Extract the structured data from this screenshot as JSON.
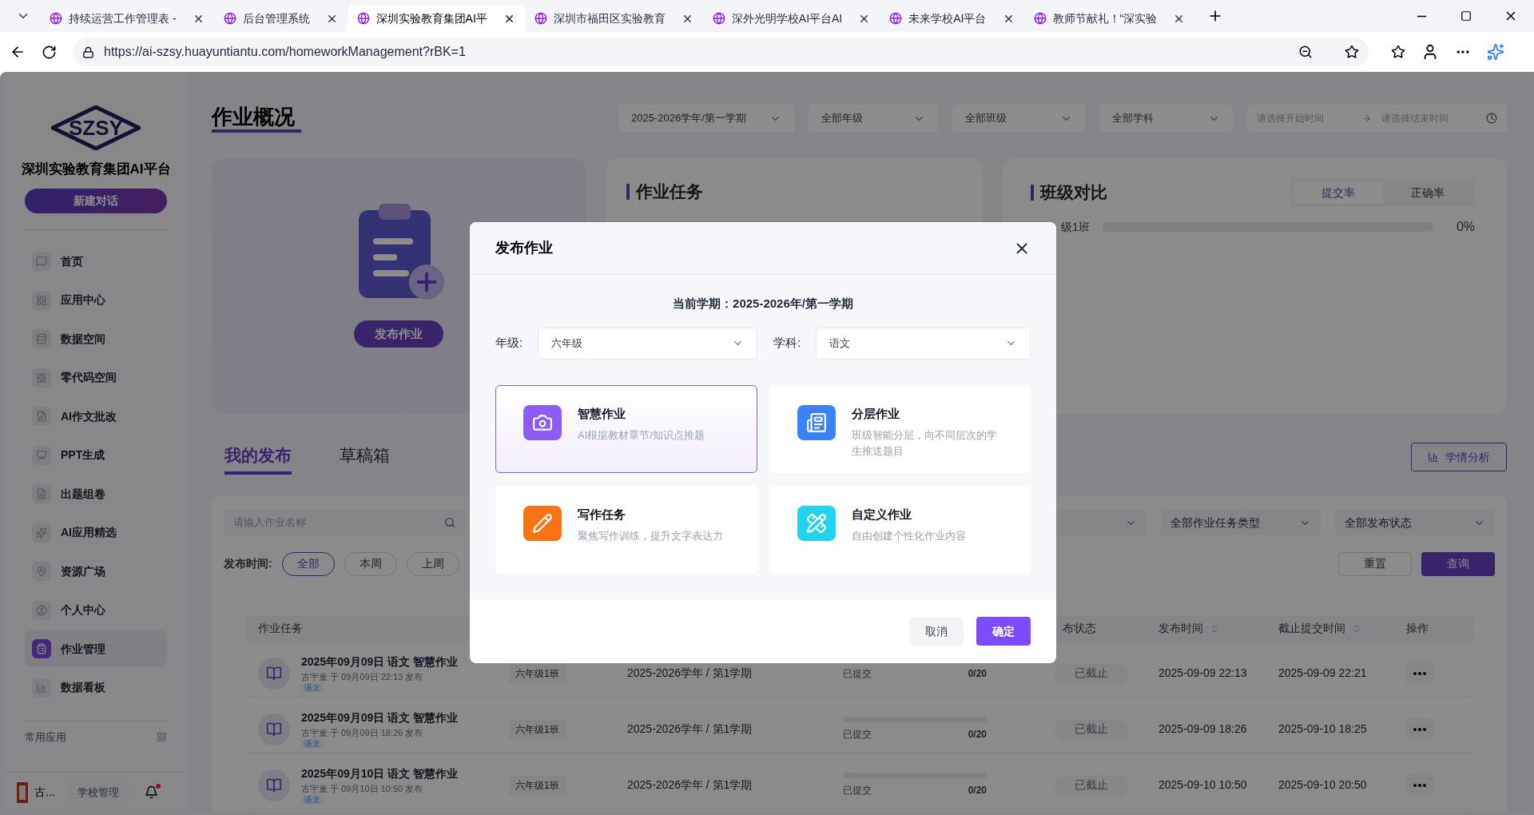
{
  "browser": {
    "tabs": [
      {
        "title": "持续运营工作管理表 -",
        "selected": false
      },
      {
        "title": "后台管理系统",
        "selected": false
      },
      {
        "title": "深圳实验教育集团AI平",
        "selected": true
      },
      {
        "title": "深圳市福田区实验教育",
        "selected": false
      },
      {
        "title": "深外光明学校AI平台AI",
        "selected": false
      },
      {
        "title": "未来学校AI平台",
        "selected": false
      },
      {
        "title": "教师节献礼！“深实验",
        "selected": false
      }
    ],
    "address": "https://ai-szsy.huayuntiantu.com/homeworkManagement?rBK=1"
  },
  "sidebar": {
    "logo": "SZSY",
    "title": "深圳实验教育集团AI平台",
    "new_chat": "新建对话",
    "items": [
      {
        "label": "首页",
        "selected": false
      },
      {
        "label": "应用中心",
        "selected": false
      },
      {
        "label": "数据空间",
        "selected": false
      },
      {
        "label": "零代码空间",
        "selected": false
      },
      {
        "label": "AI作文批改",
        "selected": false
      },
      {
        "label": "PPT生成",
        "selected": false
      },
      {
        "label": "出题组卷",
        "selected": false
      },
      {
        "label": "AI应用精选",
        "selected": false
      },
      {
        "label": "资源广场",
        "selected": false
      },
      {
        "label": "个人中心",
        "selected": false
      },
      {
        "label": "作业管理",
        "selected": true
      },
      {
        "label": "数据看板",
        "selected": false
      }
    ],
    "section": "常用应用",
    "user": "古...",
    "school_button": "学校管理",
    "notification": true
  },
  "header": {
    "title": "作业概况",
    "filters": [
      "2025-2026学年/第一学期",
      "全部年级",
      "全部班级",
      "全部学科"
    ],
    "date_start": {
      "placeholder": "请选择开始时间"
    },
    "date_end": {
      "placeholder": "请选择结束时间"
    }
  },
  "publish_card": {
    "button": "发布作业"
  },
  "task_card": {
    "title": "作业任务"
  },
  "compare_card": {
    "title": "班级对比",
    "tabs": [
      {
        "label": "提交率",
        "selected": true
      },
      {
        "label": "正确率",
        "selected": false
      }
    ],
    "rows": [
      {
        "label": "级1班",
        "level": 0,
        "reading": "0%"
      }
    ]
  },
  "list_tabs": [
    {
      "label": "我的发布",
      "selected": true
    },
    {
      "label": "草稿箱",
      "selected": false
    }
  ],
  "analysis_button": "学情分析",
  "filters": {
    "search": {
      "placeholder": "请输入作业名称"
    },
    "time_label": "发布时间:",
    "time_chips": [
      {
        "label": "全部",
        "selected": true
      },
      {
        "label": "本周",
        "selected": false
      },
      {
        "label": "上周",
        "selected": false
      }
    ],
    "selects": [
      "全部作业任务类型",
      "全部发布状态"
    ],
    "reset": "重置",
    "query": "查询"
  },
  "table": {
    "columns": [
      "作业任务",
      "布状态",
      "发布时间",
      "截止提交时间",
      "操作"
    ],
    "rows": [
      {
        "title": "2025年09月09日 语文 智慧作业",
        "byline": "古宇童 于 09月09日 22:13 发布",
        "tag": "语文",
        "class": "六年级1班",
        "term": "2025-2026学年 / 第1学期",
        "progress_label": "已提交",
        "count": "0/20",
        "status": "已截止",
        "published": "2025-09-09 22:13",
        "deadline": "2025-09-09 22:21"
      },
      {
        "title": "2025年09月09日 语文 智慧作业",
        "byline": "古宇童 于 09月09日 18:26 发布",
        "tag": "语文",
        "class": "六年级1班",
        "term": "2025-2026学年 / 第1学期",
        "progress_label": "已提交",
        "level": 0,
        "count": "0/20",
        "status": "已截止",
        "published": "2025-09-09 18:26",
        "deadline": "2025-09-10 18:25"
      },
      {
        "title": "2025年09月10日 语文 智慧作业",
        "byline": "古宇童 于 09月10日 10:50 发布",
        "tag": "语文",
        "class": "六年级1班",
        "term": "2025-2026学年 / 第1学期",
        "progress_label": "已提交",
        "level": 0,
        "count": "0/20",
        "status": "已截止",
        "published": "2025-09-10 10:50",
        "deadline": "2025-09-10 20:50"
      }
    ]
  },
  "dialog": {
    "title": "发布作业",
    "term": "当前学期：2025-2026年/第一学期",
    "grade_label": "年级:",
    "grade": "六年级",
    "subject_label": "学科:",
    "subject": "语文",
    "options": [
      {
        "title": "智慧作业",
        "description": "AI根据教材章节/知识点推题",
        "selected": true
      },
      {
        "title": "分层作业",
        "description": "班级智能分层，向不同层次的学生推送题目",
        "selected": false
      },
      {
        "title": "写作任务",
        "description": "聚焦写作训练，提升文字表达力",
        "selected": false
      },
      {
        "title": "自定义作业",
        "description": "自由创建个性化作业内容",
        "selected": false
      }
    ],
    "cancel": "取消",
    "confirm": "确定"
  }
}
